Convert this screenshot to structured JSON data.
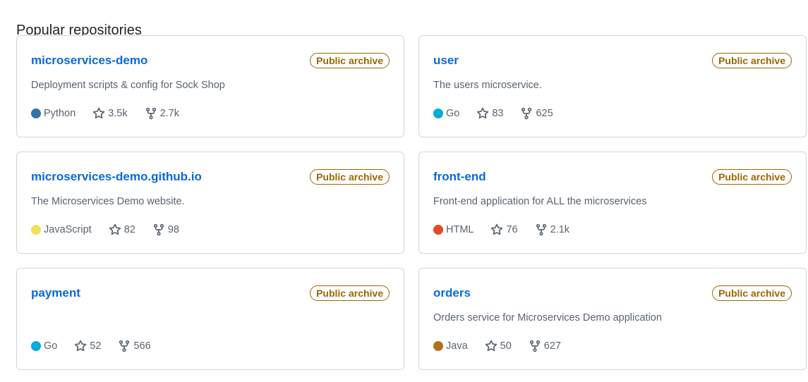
{
  "section": {
    "title": "Popular repositories"
  },
  "repos": [
    {
      "name": "microservices-demo",
      "badge": "Public archive",
      "description": "Deployment scripts & config for Sock Shop",
      "language": "Python",
      "language_color": "#3572A5",
      "stars": "3.5k",
      "forks": "2.7k"
    },
    {
      "name": "user",
      "badge": "Public archive",
      "description": "The users microservice.",
      "language": "Go",
      "language_color": "#00ADD8",
      "stars": "83",
      "forks": "625"
    },
    {
      "name": "microservices-demo.github.io",
      "badge": "Public archive",
      "description": "The Microservices Demo website.",
      "language": "JavaScript",
      "language_color": "#f1e05a",
      "stars": "82",
      "forks": "98"
    },
    {
      "name": "front-end",
      "badge": "Public archive",
      "description": "Front-end application for ALL the microservices",
      "language": "HTML",
      "language_color": "#e34c26",
      "stars": "76",
      "forks": "2.1k"
    },
    {
      "name": "payment",
      "badge": "Public archive",
      "description": "",
      "language": "Go",
      "language_color": "#00ADD8",
      "stars": "52",
      "forks": "566"
    },
    {
      "name": "orders",
      "badge": "Public archive",
      "description": "Orders service for Microservices Demo application",
      "language": "Java",
      "language_color": "#b07219",
      "stars": "50",
      "forks": "627"
    }
  ],
  "icons": {
    "star": "star-icon",
    "fork": "fork-icon"
  }
}
